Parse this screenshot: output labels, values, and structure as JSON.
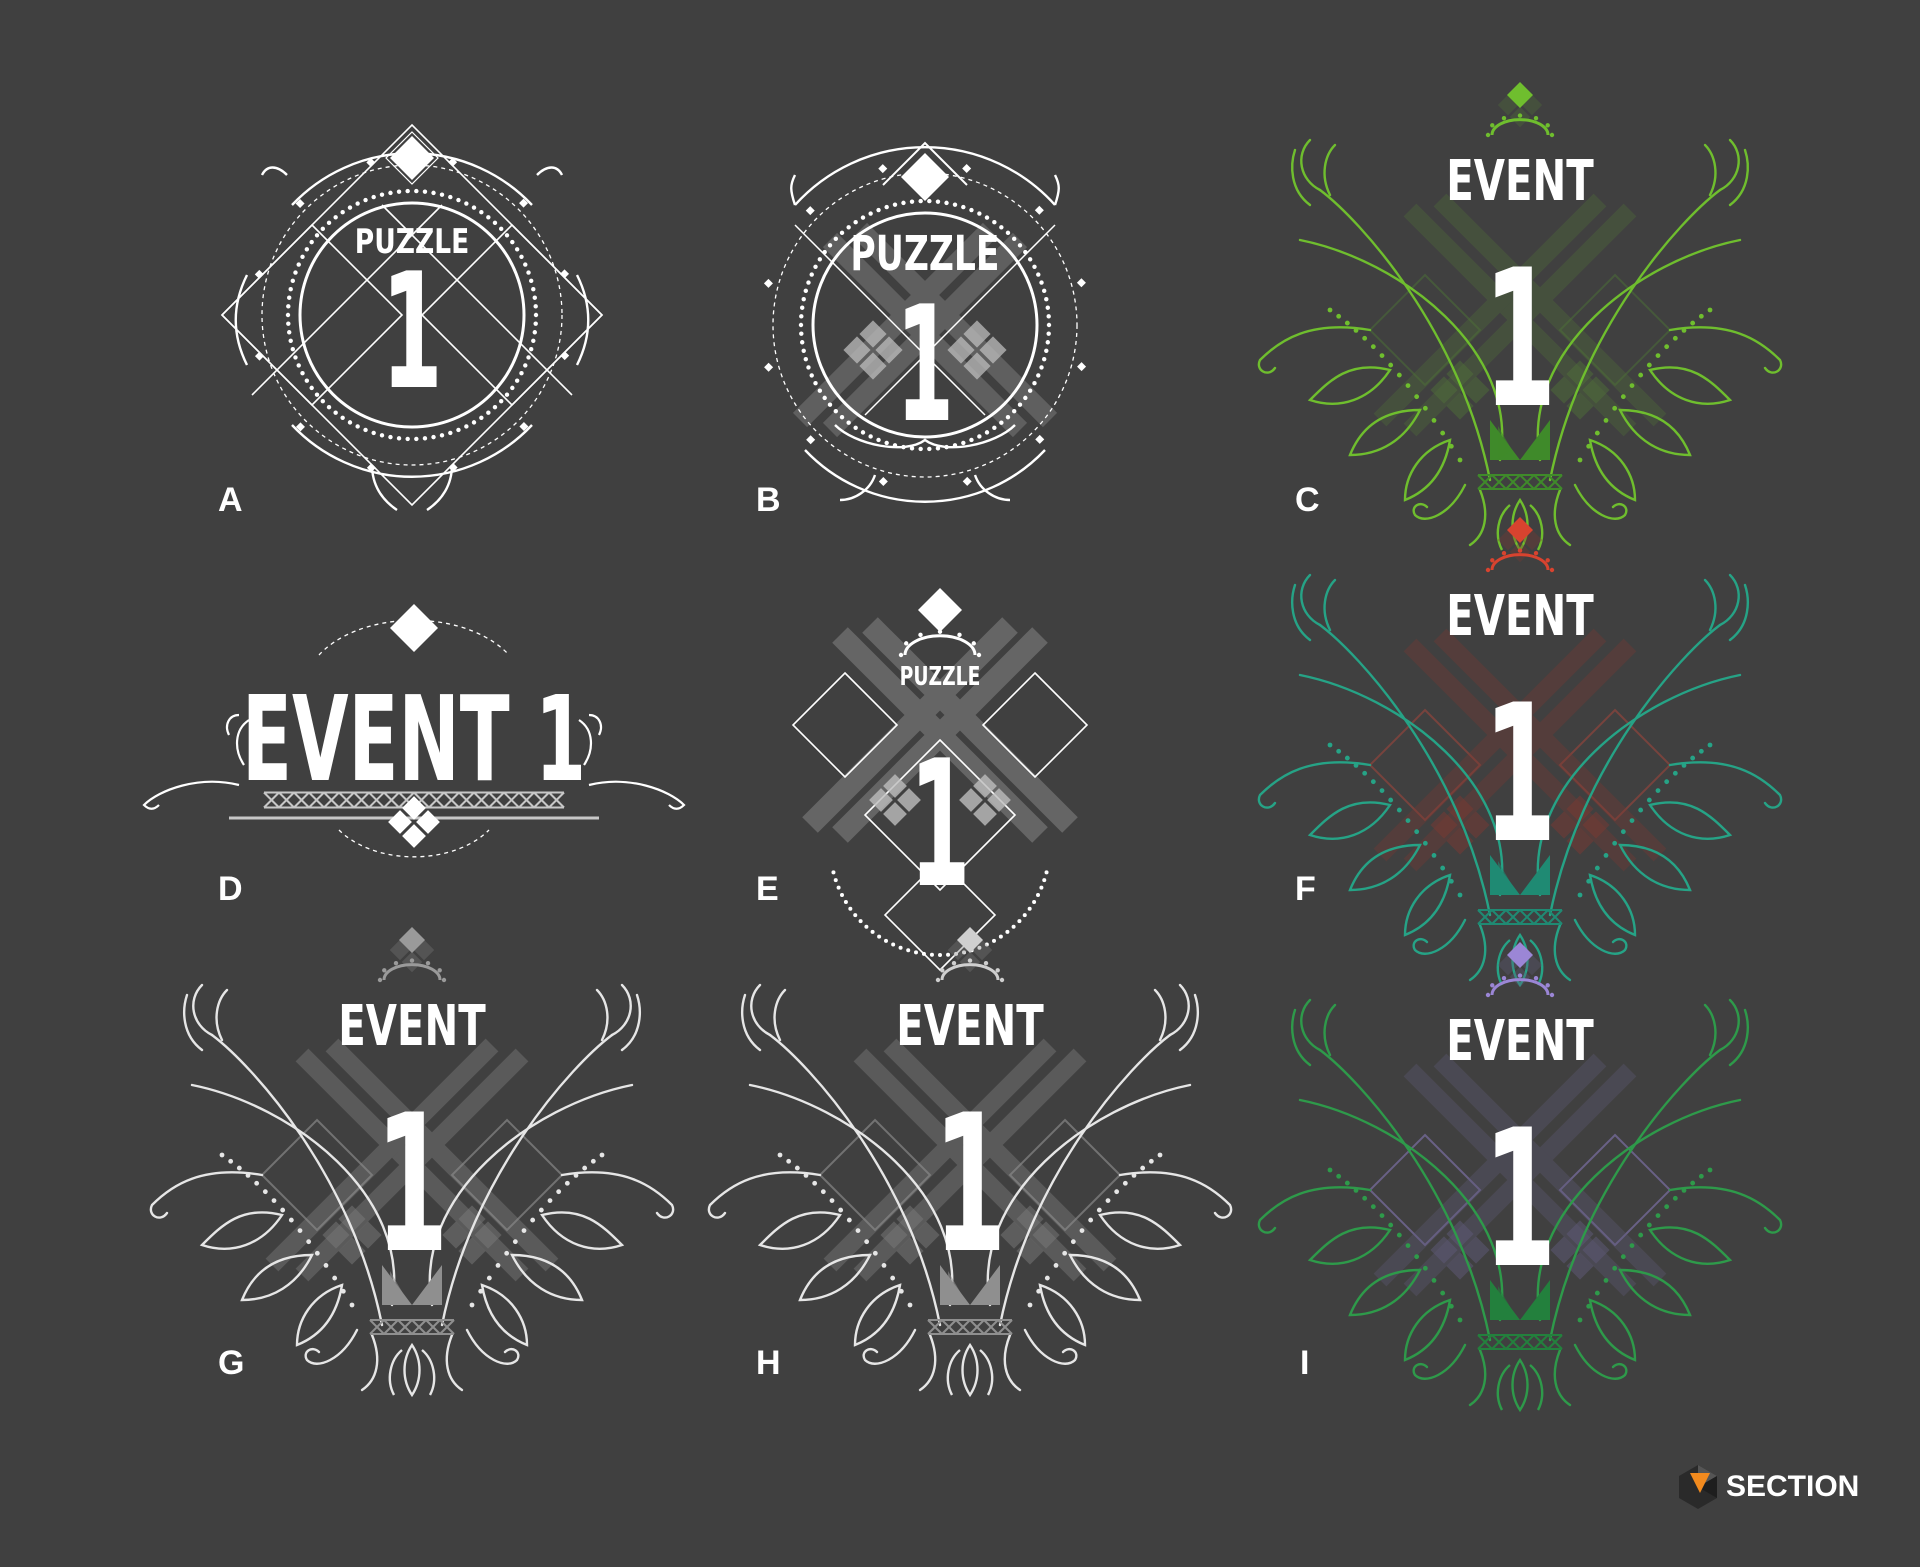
{
  "colors": {
    "background": "#404040",
    "white": "#ffffff",
    "green_bright": "#6fbe2e",
    "green_deep": "#2e9a4a",
    "teal": "#26a386",
    "red": "#d8432f",
    "violet": "#9b86d6",
    "gray_ornament": "#d0d0d0"
  },
  "panels": [
    {
      "id": "A",
      "letter": "A",
      "top": "PUZZLE",
      "number": "1",
      "style": "puzzle-frame",
      "accent": "#ffffff"
    },
    {
      "id": "B",
      "letter": "B",
      "top": "PUZZLE",
      "number": "1",
      "style": "puzzle-bold",
      "accent": "#ffffff"
    },
    {
      "id": "C",
      "letter": "C",
      "top": "EVENT",
      "number": "1",
      "style": "event-wings",
      "accent": "#6fbe2e",
      "wing": "#6fbe2e",
      "base": "#3f8a2a"
    },
    {
      "id": "D",
      "letter": "D",
      "top": "EVENT 1",
      "number": "",
      "style": "event-banner",
      "accent": "#ffffff"
    },
    {
      "id": "E",
      "letter": "E",
      "top": "PUZZLE",
      "number": "1",
      "style": "puzzle-diamonds",
      "accent": "#ffffff"
    },
    {
      "id": "F",
      "letter": "F",
      "top": "EVENT",
      "number": "1",
      "style": "event-wings",
      "accent": "#d8432f",
      "wing": "#26a386",
      "base": "#1f8a73"
    },
    {
      "id": "G",
      "letter": "G",
      "top": "EVENT",
      "number": "1",
      "style": "event-wings",
      "accent": "#9a9a9a",
      "wing": "#e6e6e6",
      "base": "#8f8f8f"
    },
    {
      "id": "H",
      "letter": "H",
      "top": "EVENT",
      "number": "1",
      "style": "event-wings",
      "accent": "#cfcfcf",
      "wing": "#e6e6e6",
      "base": "#8f8f8f"
    },
    {
      "id": "I",
      "letter": "I",
      "top": "EVENT",
      "number": "1",
      "style": "event-wings",
      "accent": "#9b86d6",
      "wing": "#2e9a4a",
      "base": "#23803d"
    }
  ],
  "logo": {
    "text": "SECTION",
    "icon": "section-hexagon-logo-icon",
    "accent": "#f28a1e"
  }
}
